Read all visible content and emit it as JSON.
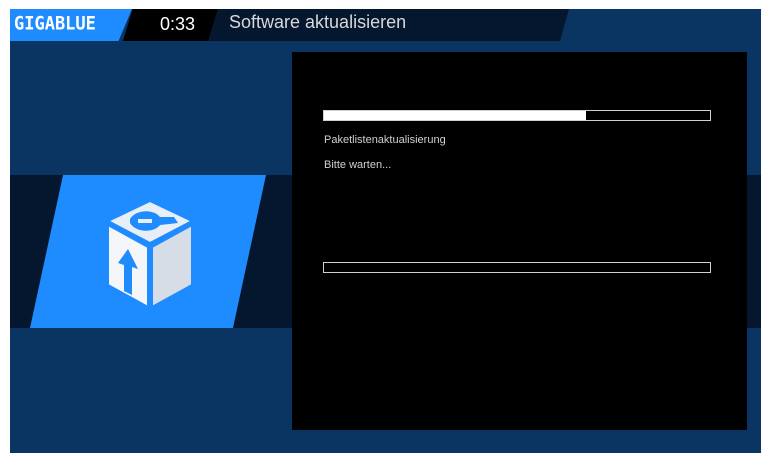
{
  "header": {
    "logo_text": "GIGABLUE",
    "clock": "0:33",
    "title": "Software aktualisieren"
  },
  "icon": {
    "name": "software-update-cube-icon"
  },
  "progress": {
    "main_fraction": 0.68,
    "secondary_fraction": 0.0
  },
  "status": {
    "line1": "Paketlistenaktualisierung",
    "line2": "Bitte warten..."
  },
  "colors": {
    "accent": "#1e8bff",
    "background": "#0a3462",
    "band": "#04172e",
    "panel": "#000000"
  }
}
